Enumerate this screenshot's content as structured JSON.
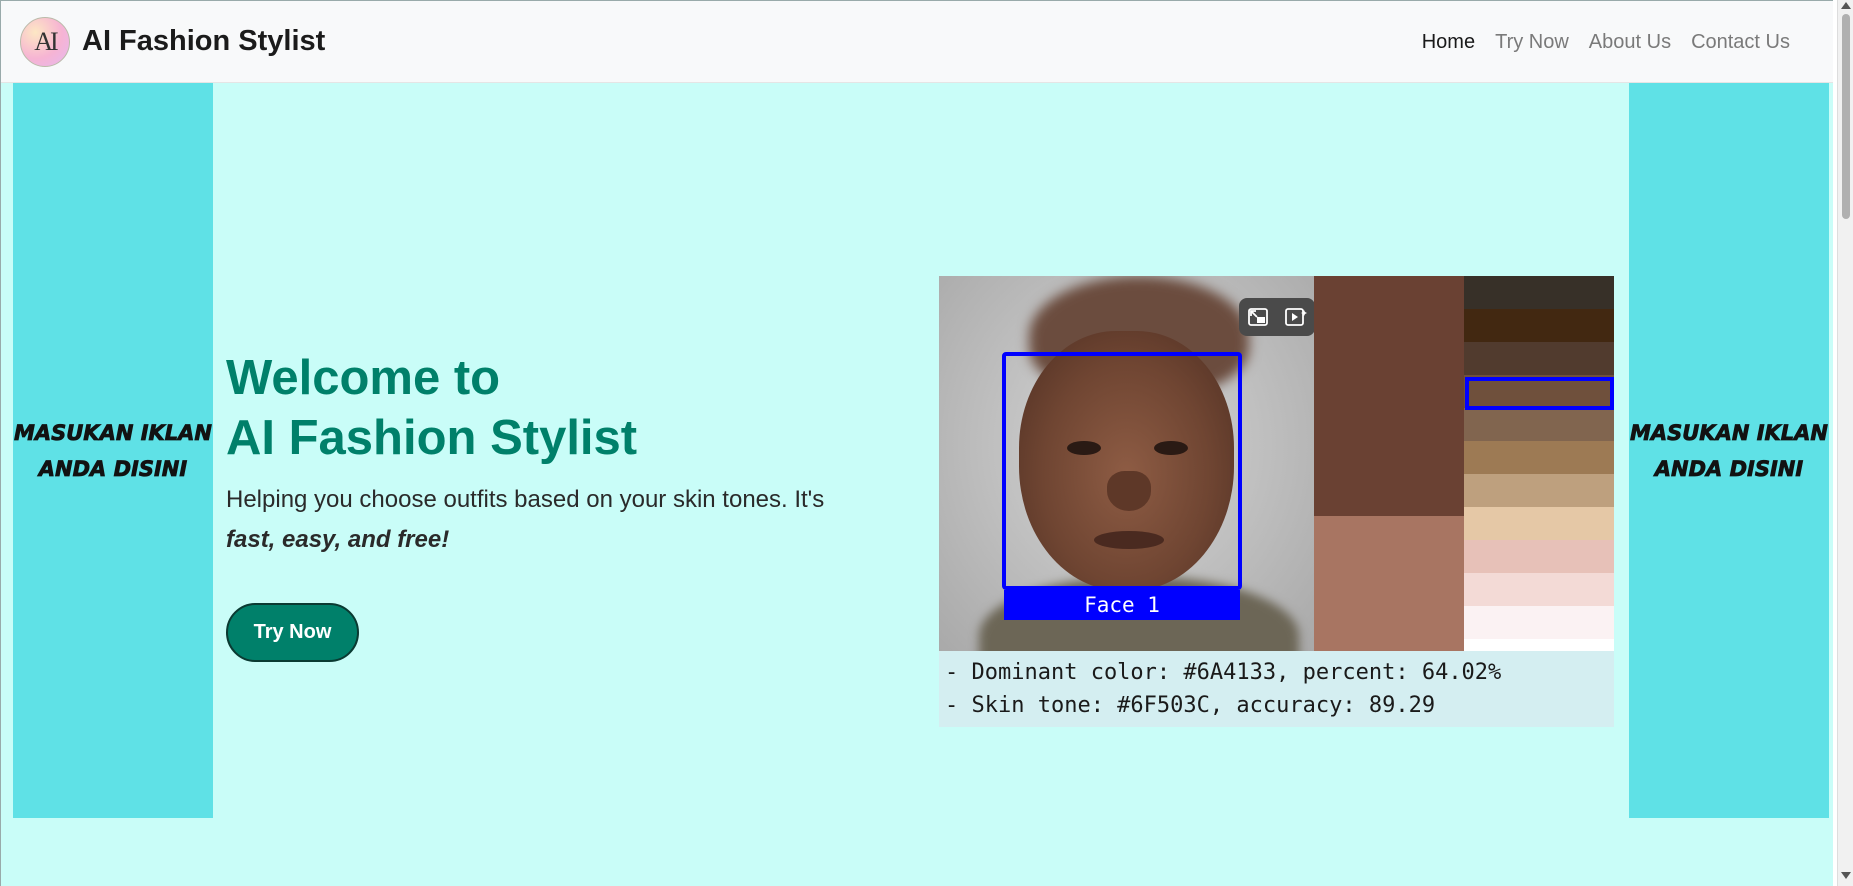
{
  "navbar": {
    "logo_text": "AI",
    "brand": "AI Fashion Stylist",
    "links": [
      {
        "label": "Home",
        "active": true
      },
      {
        "label": "Try Now",
        "active": false
      },
      {
        "label": "About Us",
        "active": false
      },
      {
        "label": "Contact Us",
        "active": false
      }
    ]
  },
  "ads": {
    "left": {
      "line1": "MASUKAN IKLAN",
      "line2": "ANDA DISINI"
    },
    "right": {
      "line1": "MASUKAN IKLAN",
      "line2": "ANDA DISINI"
    }
  },
  "hero": {
    "title_line1": "Welcome to",
    "title_line2": "AI Fashion Stylist",
    "desc_plain": "Helping you choose outfits based on your skin tones. It's",
    "desc_emphasis": "fast, easy, and free!",
    "cta_label": "Try Now"
  },
  "analysis": {
    "face_label": "Face 1",
    "dominant_line": "- Dominant color: #6A4133, percent: 64.02%",
    "skin_line": "- Skin tone: #6F503C, accuracy: 89.29",
    "dominant_colors": [
      "#6A4133",
      "#A87562"
    ],
    "palette": [
      "#373028",
      "#422811",
      "#513B2E",
      "#6F503C",
      "#81654F",
      "#9D7A54",
      "#BEA07E",
      "#E5C8A6",
      "#E7C1B8",
      "#F3DAD6",
      "#FBF2F3",
      "#FFFFFF"
    ],
    "selected_index": 3,
    "controls": [
      "exit-pip-icon",
      "play-visual-search-icon"
    ]
  },
  "colors": {
    "accent": "#00806A",
    "background": "#C9FDF8",
    "ad_background": "#5FE1E6",
    "face_box": "#0000FF"
  }
}
